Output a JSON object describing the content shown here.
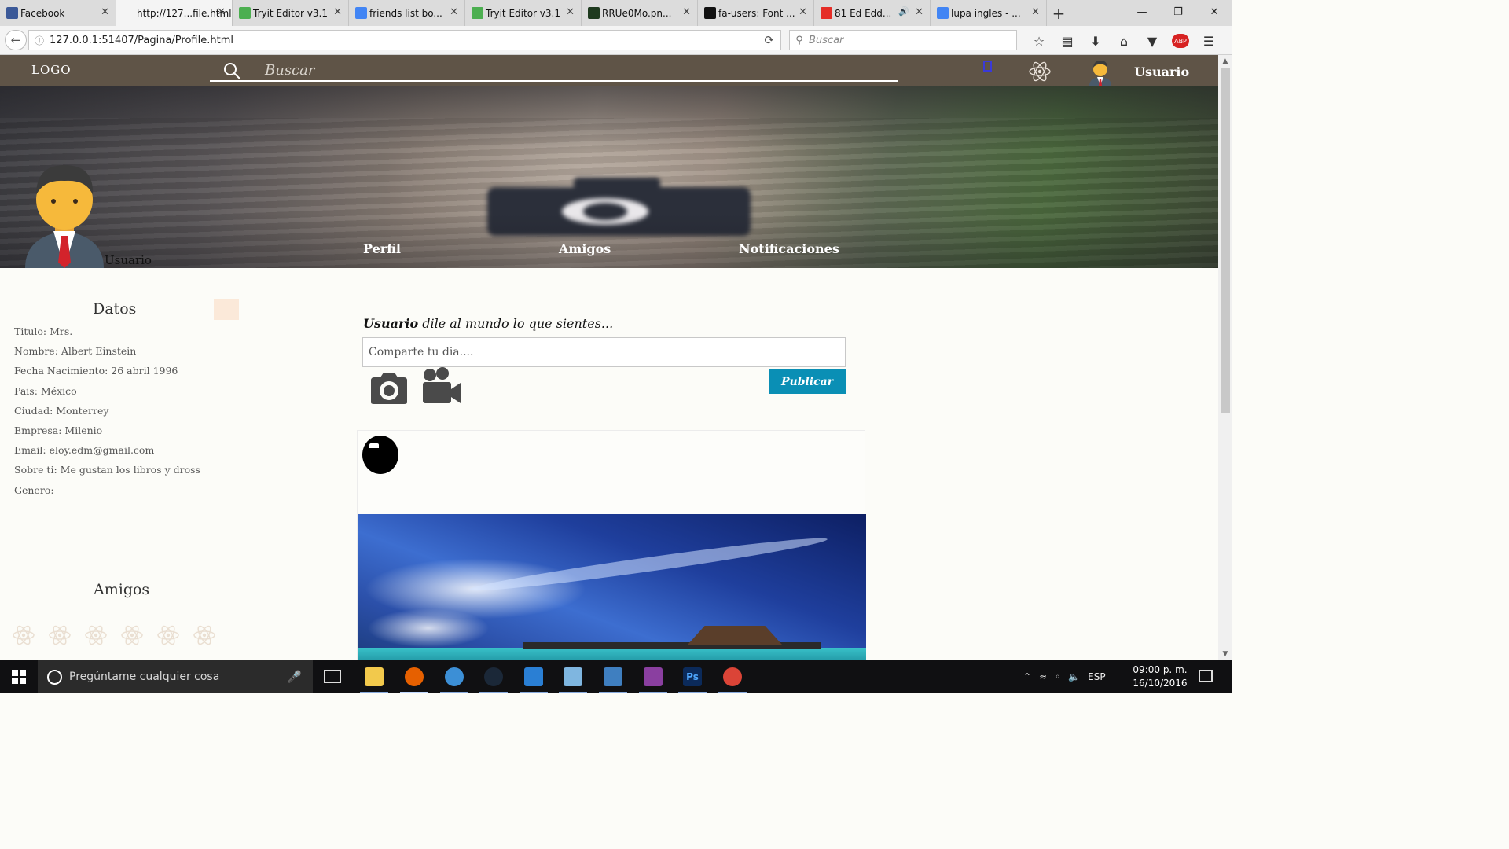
{
  "browser": {
    "tabs": [
      {
        "title": "Facebook",
        "favicon_color": "#3b5998"
      },
      {
        "title": "http://127...file.html",
        "favicon_color": "",
        "active": true
      },
      {
        "title": "Tryit Editor v3.1",
        "favicon_color": "#4caf50"
      },
      {
        "title": "friends list bo...",
        "favicon_color": "#4285f4"
      },
      {
        "title": "Tryit Editor v3.1",
        "favicon_color": "#4caf50"
      },
      {
        "title": "RRUe0Mo.pn...",
        "favicon_color": "#1e3a1e"
      },
      {
        "title": "fa-users: Font ...",
        "favicon_color": "#111111"
      },
      {
        "title": "81 Ed Edd...",
        "favicon_color": "#e52d27",
        "audio": true
      },
      {
        "title": "lupa ingles - ...",
        "favicon_color": "#4285f4"
      }
    ],
    "new_tab": "+",
    "url": "127.0.0.1:51407/Pagina/Profile.html",
    "search_placeholder": "Buscar",
    "abp_label": "ABP"
  },
  "site": {
    "logo": "LOGO",
    "search_placeholder": "Buscar",
    "user_name": "Usuario",
    "accent_color": "#0a8fb5",
    "header_color": "#5f5447"
  },
  "cover": {
    "profile_name": "Usuario",
    "nav": [
      {
        "label": "Perfil"
      },
      {
        "label": "Amigos"
      },
      {
        "label": "Notificaciones"
      }
    ]
  },
  "datos": {
    "title": "Datos",
    "fields": [
      "Titulo: Mrs.",
      "Nombre: Albert Einstein",
      "Fecha Nacimiento: 26 abril 1996",
      "Pais: México",
      "Ciudad: Monterrey",
      "Empresa: Milenio",
      "Email: eloy.edm@gmail.com",
      "Sobre ti: Me gustan los libros y dross",
      "Genero:"
    ]
  },
  "amigos": {
    "title": "Amigos",
    "icon": "atom-icon",
    "count": 6
  },
  "composer": {
    "user": "Usuario",
    "prompt": "dile al mundo lo que sientes...",
    "placeholder": "Comparte tu dia....",
    "publish_label": "Publicar"
  },
  "taskbar": {
    "search_placeholder": "Pregúntame cualquier cosa",
    "apps": [
      {
        "name": "file-explorer",
        "color": "#f2c94c"
      },
      {
        "name": "firefox",
        "color": "#e66000",
        "active": true
      },
      {
        "name": "globe-app",
        "color": "#3c8fd6"
      },
      {
        "name": "steam",
        "color": "#1b2838"
      },
      {
        "name": "app-window",
        "color": "#2a7fd4"
      },
      {
        "name": "paint-app",
        "color": "#7fb6e0"
      },
      {
        "name": "monitor-app",
        "color": "#3f7fc0"
      },
      {
        "name": "winrar",
        "color": "#8a3fa0"
      },
      {
        "name": "photoshop",
        "label": "Ps",
        "color": "#0b2a5a"
      },
      {
        "name": "chrome",
        "color": "#db4437"
      }
    ],
    "language": "ESP",
    "time": "09:00 p. m.",
    "date": "16/10/2016"
  }
}
